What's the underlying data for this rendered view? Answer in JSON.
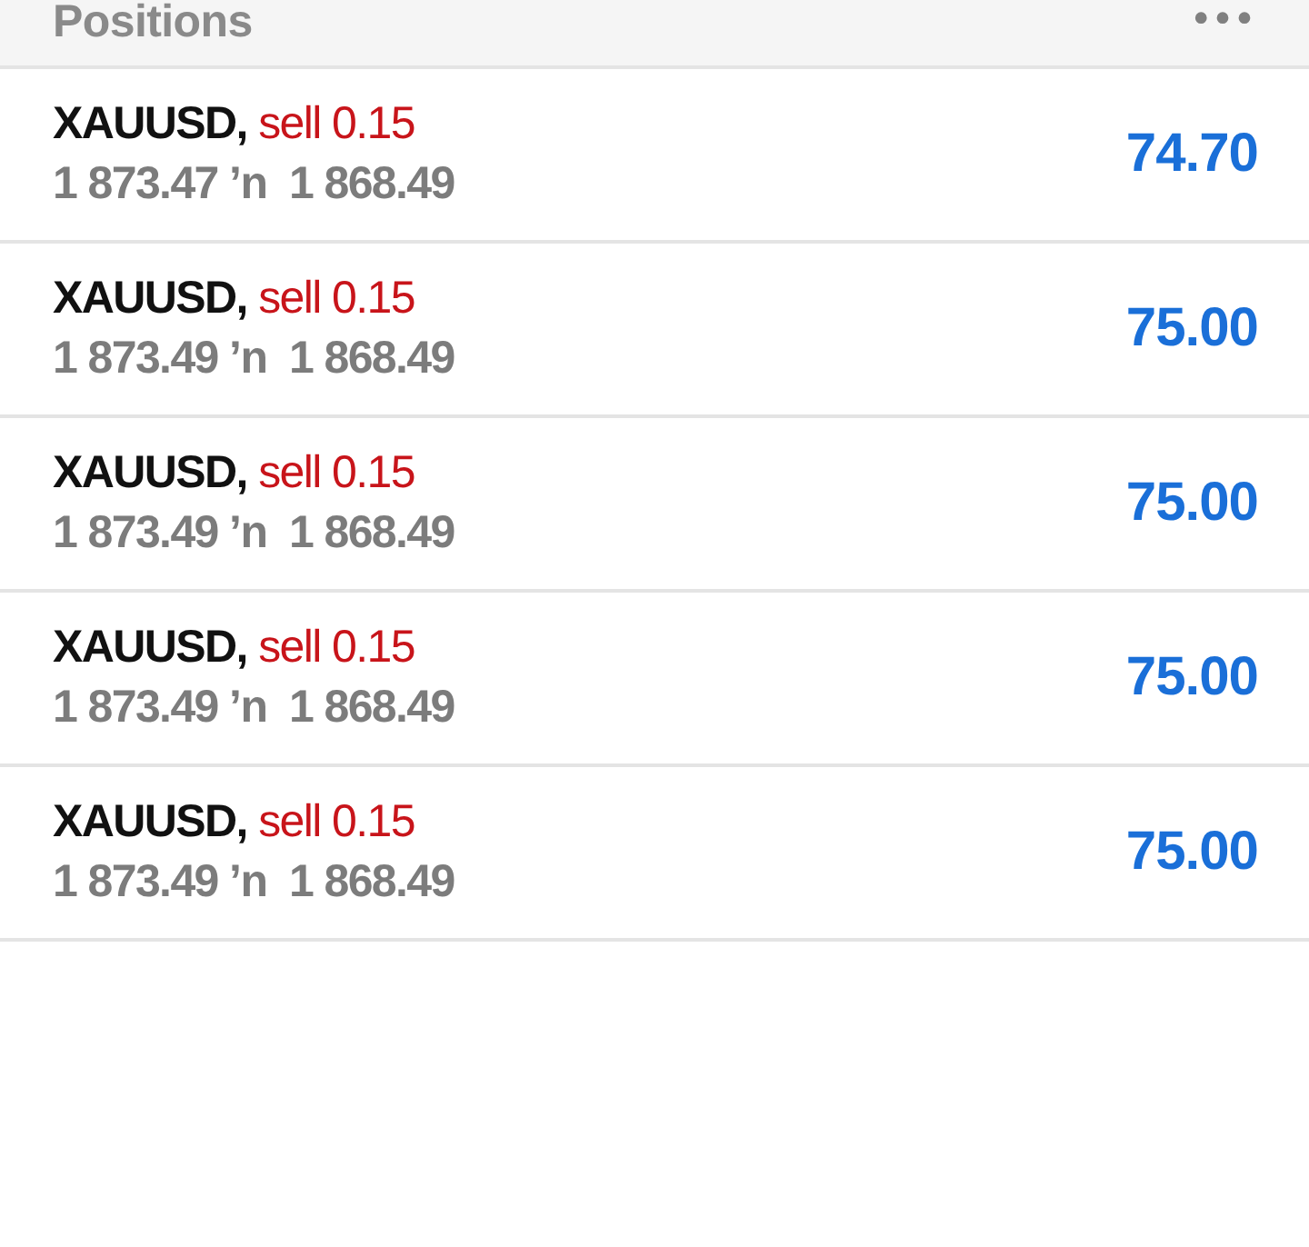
{
  "header": {
    "title": "Positions",
    "menu": "•••"
  },
  "positions": [
    {
      "symbol": "XAUUSD,",
      "order": "sell 0.15",
      "prices": "1 873.47 ʼn  1 868.49",
      "profit": "74.70"
    },
    {
      "symbol": "XAUUSD,",
      "order": "sell 0.15",
      "prices": "1 873.49 ʼn  1 868.49",
      "profit": "75.00"
    },
    {
      "symbol": "XAUUSD,",
      "order": "sell 0.15",
      "prices": "1 873.49 ʼn  1 868.49",
      "profit": "75.00"
    },
    {
      "symbol": "XAUUSD,",
      "order": "sell 0.15",
      "prices": "1 873.49 ʼn  1 868.49",
      "profit": "75.00"
    },
    {
      "symbol": "XAUUSD,",
      "order": "sell 0.15",
      "prices": "1 873.49 ʼn  1 868.49",
      "profit": "75.00"
    }
  ]
}
